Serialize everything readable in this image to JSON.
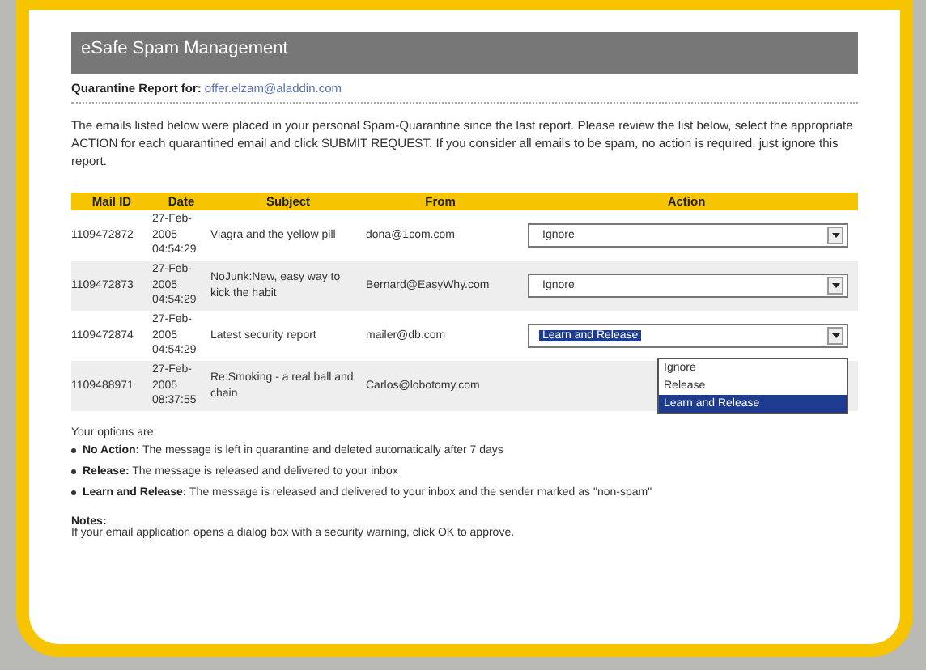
{
  "header": {
    "title": "eSafe Spam Management"
  },
  "report": {
    "label": "Quarantine Report for:",
    "email": "offer.elzam@aladdin.com"
  },
  "intro": "The emails listed below were placed in your personal Spam-Quarantine since the last report. Please review the list below, select the appropriate ACTION for each quarantined email and click SUBMIT REQUEST. If you consider all emails to be spam, no action is required, just ignore this report.",
  "table": {
    "columns": [
      "Mail ID",
      "Date",
      "Subject",
      "From",
      "Action"
    ],
    "rows": [
      {
        "mail_id": "1109472872",
        "date": "27-Feb-2005 04:54:29",
        "subject": "Viagra and the yellow pill",
        "from": "dona@1com.com",
        "action": {
          "value": "Ignore",
          "open": false
        }
      },
      {
        "mail_id": "1109472873",
        "date": "27-Feb-2005 04:54:29",
        "subject": "NoJunk:New, easy way to kick the habit",
        "from": "Bernard@EasyWhy.com",
        "action": {
          "value": "Ignore",
          "open": false
        }
      },
      {
        "mail_id": "1109472874",
        "date": "27-Feb-2005 04:54:29",
        "subject": "Latest security report",
        "from": "mailer@db.com",
        "action": {
          "value": "Learn and Release",
          "open": true,
          "options": [
            {
              "label": "Ignore",
              "selected": false
            },
            {
              "label": "Release",
              "selected": false
            },
            {
              "label": "Learn and Release",
              "selected": true
            }
          ]
        }
      },
      {
        "mail_id": "1109488971",
        "date": "27-Feb-2005 08:37:55",
        "subject": "Re:Smoking - a real ball and chain",
        "from": "Carlos@lobotomy.com"
      }
    ]
  },
  "options_intro": "Your options are:",
  "options": [
    {
      "term": "No Action:",
      "text": "The message is left in quarantine and deleted automatically after 7 days"
    },
    {
      "term": "Release:",
      "text": "The message is released and delivered to your inbox"
    },
    {
      "term": "Learn and Release:",
      "text": "The message is released and delivered to your inbox and the sender marked as \"non-spam\""
    }
  ],
  "notes": {
    "title": "Notes:",
    "text": "If your email application opens a dialog box with a security warning, click OK to approve."
  }
}
